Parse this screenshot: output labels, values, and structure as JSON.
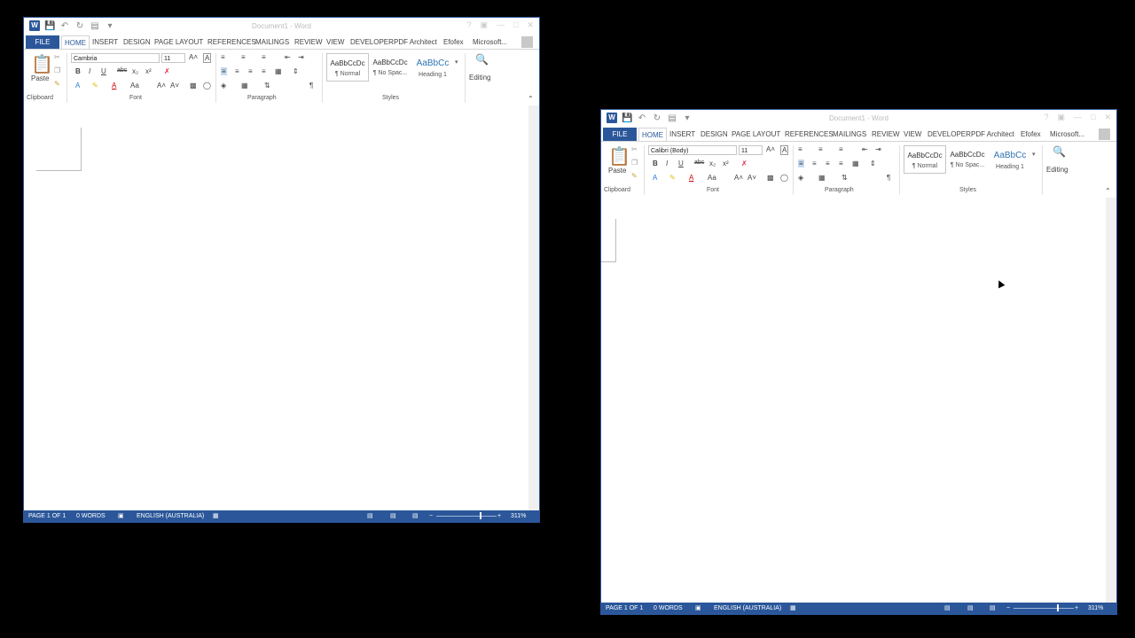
{
  "window_title": "Document1 - Word",
  "qat": {
    "save_icon": "save-icon",
    "undo_icon": "undo-icon",
    "redo_icon": "redo-icon",
    "touch_icon": "touch-mode-icon"
  },
  "tabs": [
    "FILE",
    "HOME",
    "INSERT",
    "DESIGN",
    "PAGE LAYOUT",
    "REFERENCES",
    "MAILINGS",
    "REVIEW",
    "VIEW",
    "DEVELOPER",
    "PDF Architect",
    "Efofex"
  ],
  "account": "Microsoft...",
  "ribbon": {
    "clipboard": {
      "paste": "Paste",
      "label": "Clipboard"
    },
    "font": {
      "label": "Font",
      "bold": "B",
      "italic": "I",
      "underline": "U",
      "strike": "abc",
      "sub": "x₂",
      "sup": "x²",
      "grow": "A˄",
      "shrink": "A˅",
      "case": "Aa",
      "clear": "A"
    },
    "paragraph": {
      "label": "Paragraph",
      "pilcrow": "¶"
    },
    "styles": {
      "label": "Styles",
      "items": [
        {
          "preview": "AaBbCcDc",
          "name": "¶ Normal"
        },
        {
          "preview": "AaBbCcDc",
          "name": "¶ No Spac..."
        },
        {
          "preview": "AaBbCc",
          "name": "Heading 1"
        }
      ]
    },
    "editing": {
      "label": "Editing"
    }
  },
  "windows": [
    {
      "font_name": "Cambria",
      "font_size": "11"
    },
    {
      "font_name": "Calibri (Body)",
      "font_size": "11"
    }
  ],
  "status": {
    "page": "PAGE 1 OF 1",
    "words": "0 WORDS",
    "language": "ENGLISH (AUSTRALIA)",
    "zoom": "311%"
  }
}
